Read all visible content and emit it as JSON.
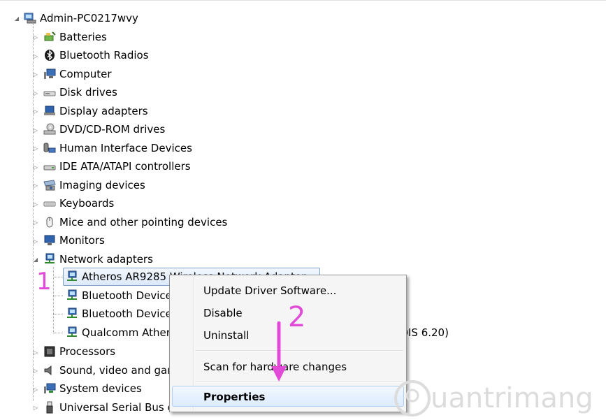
{
  "root": {
    "label": "Admin-PC0217wvy",
    "icon": "computer-root-icon"
  },
  "categories": [
    {
      "label": "Batteries",
      "icon": "battery-icon"
    },
    {
      "label": "Bluetooth Radios",
      "icon": "bluetooth-icon"
    },
    {
      "label": "Computer",
      "icon": "computer-icon"
    },
    {
      "label": "Disk drives",
      "icon": "disk-drive-icon"
    },
    {
      "label": "Display adapters",
      "icon": "display-adapter-icon"
    },
    {
      "label": "DVD/CD-ROM drives",
      "icon": "dvd-drive-icon"
    },
    {
      "label": "Human Interface Devices",
      "icon": "hid-icon"
    },
    {
      "label": "IDE ATA/ATAPI controllers",
      "icon": "ide-controller-icon"
    },
    {
      "label": "Imaging devices",
      "icon": "camera-icon"
    },
    {
      "label": "Keyboards",
      "icon": "keyboard-icon"
    },
    {
      "label": "Mice and other pointing devices",
      "icon": "mouse-icon"
    },
    {
      "label": "Monitors",
      "icon": "monitor-icon"
    },
    {
      "label": "Network adapters",
      "icon": "network-adapter-icon"
    }
  ],
  "network_children": [
    {
      "label": "Atheros AR9285 Wireless Network Adapter",
      "selected": true
    },
    {
      "label": "Bluetooth Device (Personal Area Network)"
    },
    {
      "label": "Bluetooth Device (RFCOMM Protocol TDI)"
    },
    {
      "label": "Qualcomm Atheros AR8152 PCI-E Fast Ethernet Controller (NDIS 6.20)"
    }
  ],
  "after_categories": [
    {
      "label": "Processors",
      "icon": "processor-icon"
    },
    {
      "label": "Sound, video and game controllers",
      "icon": "speaker-icon"
    },
    {
      "label": "System devices",
      "icon": "system-device-icon"
    },
    {
      "label": "Universal Serial Bus controllers",
      "icon": "usb-icon"
    }
  ],
  "context_menu": {
    "items": [
      "Update Driver Software...",
      "Disable",
      "Uninstall",
      "Scan for hardware changes",
      "Properties"
    ],
    "highlighted": "Properties"
  },
  "annotations": {
    "step1": "1",
    "step2": "2",
    "color": "#e24bd8"
  },
  "watermark": "uantrimang"
}
